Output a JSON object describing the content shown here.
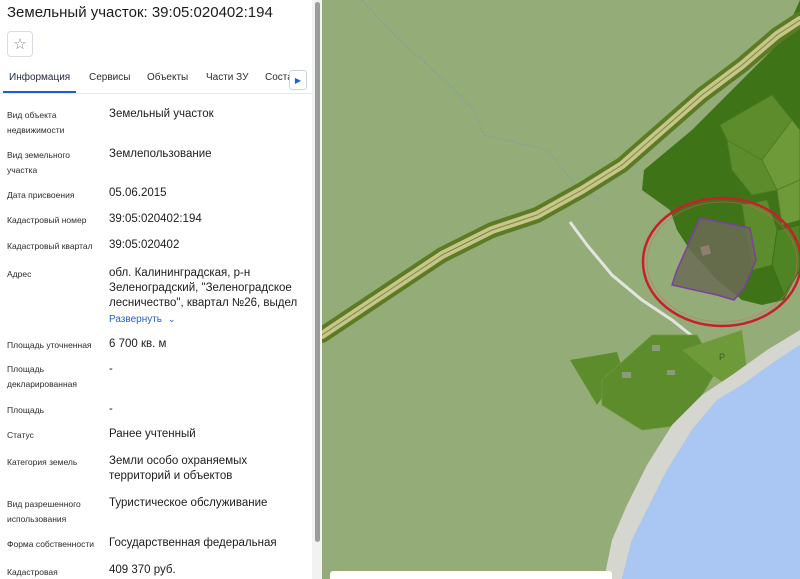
{
  "panel": {
    "title": "Земельный участок: 39:05:020402:194",
    "favorite_icon": "star-outline-icon",
    "tabs": [
      "Информация",
      "Сервисы",
      "Объекты",
      "Части ЗУ",
      "Соста"
    ],
    "active_tab": "Информация",
    "tabs_next_icon": "chevron-right-icon",
    "fields": [
      {
        "label": "Вид объекта недвижимости",
        "value": "Земельный участок"
      },
      {
        "label": "Вид земельного участка",
        "value": "Землепользование"
      },
      {
        "label": "Дата присвоения",
        "value": "05.06.2015"
      },
      {
        "label": "Кадастровый номер",
        "value": "39:05:020402:194"
      },
      {
        "label": "Кадастровый квартал",
        "value": "39:05:020402"
      },
      {
        "label": "Адрес",
        "value": "обл. Калининградская, р-н Зеленоградский, \"Зеленоградское лесничество\", квартал №26, выдел"
      },
      {
        "label": "Площадь уточненная",
        "value": "6 700 кв. м"
      },
      {
        "label": "Площадь декларированная",
        "value": "-"
      },
      {
        "label": "Площадь",
        "value": "-"
      },
      {
        "label": "Статус",
        "value": "Ранее учтенный"
      },
      {
        "label": "Категория земель",
        "value": "Земли особо охраняемых территорий и объектов"
      },
      {
        "label": "Вид разрешенного использования",
        "value": "Туристическое обслуживание"
      },
      {
        "label": "Форма собственности",
        "value": "Государственная федеральная"
      },
      {
        "label": "Кадастровая",
        "value": "409 370 руб."
      }
    ],
    "expand_label": "Развернуть",
    "expand_icon": "chevron-down-icon"
  },
  "map": {
    "label_p": "Р",
    "colors": {
      "background": "#93ac78",
      "forest_dark": "#3f7318",
      "forest_mid": "#5c8c2c",
      "forest_light": "#6e9a3a",
      "road_fill": "#c9c48a",
      "road_edge": "#5b7c24",
      "water": "#a9c7f2",
      "beach": "#d6d6d0",
      "selected_parcel": "#6b6b55",
      "selected_border": "#7b3fa0",
      "highlight_circle": "#c8202a"
    }
  }
}
